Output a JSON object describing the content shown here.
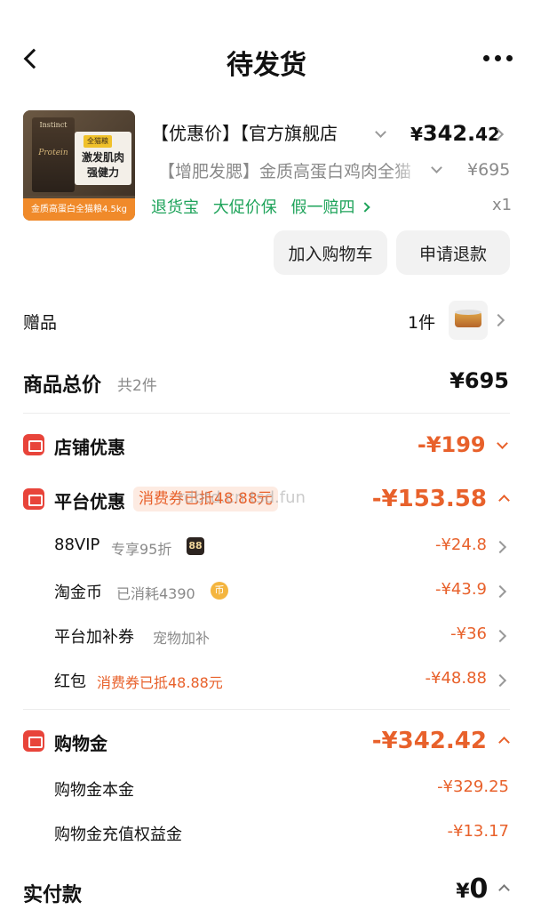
{
  "header": {
    "title": "待发货"
  },
  "product": {
    "image_brand": "Instinct",
    "image_badge": "全猫粮",
    "image_protein": "Protein",
    "image_tagline1": "激发肌肉",
    "image_tagline2": "强健力",
    "image_caption": "金质高蛋白全猫粮4.5kg",
    "title_line1": "【优惠价】【官方旗舰店",
    "price_symbol": "¥",
    "price_int": "342.",
    "price_dec": "42",
    "title_line2": "【增肥发腮】金质高蛋白鸡肉全猫",
    "orig_price": "¥695",
    "services": [
      "退货宝",
      "大促价保",
      "假一赔四"
    ],
    "quantity": "x1"
  },
  "actions": {
    "add_cart": "加入购物车",
    "refund": "申请退款"
  },
  "gift": {
    "label": "赠品",
    "count": "1件"
  },
  "total": {
    "label": "商品总价",
    "count": "共2件",
    "value": "¥695"
  },
  "store_discount": {
    "label": "店铺优惠",
    "value": "-¥199"
  },
  "platform_discount": {
    "label": "平台优惠",
    "tag": "消费券已抵48.88元",
    "watermark": "rdbtd.cn tsd.fun",
    "value": "-¥153.58",
    "items": [
      {
        "label": "88VIP",
        "note": "专享95折",
        "badge": "88",
        "value": "-¥24.8"
      },
      {
        "label": "淘金币",
        "note": "已消耗4390",
        "badge": "币",
        "value": "-¥43.9"
      },
      {
        "label": "平台加补券",
        "note": "宠物加补",
        "value": "-¥36"
      },
      {
        "label": "红包",
        "note": "消费券已抵48.88元",
        "value": "-¥48.88"
      }
    ]
  },
  "shopping_money": {
    "label": "购物金",
    "value": "-¥342.42",
    "items": [
      {
        "label": "购物金本金",
        "value": "-¥329.25"
      },
      {
        "label": "购物金充值权益金",
        "value": "-¥13.17"
      }
    ]
  },
  "paid": {
    "label": "实付款",
    "symbol": "¥",
    "value": "0"
  },
  "colors": {
    "accent": "#e8612b",
    "green": "#1ea35a",
    "red_icon": "#e8443a"
  }
}
